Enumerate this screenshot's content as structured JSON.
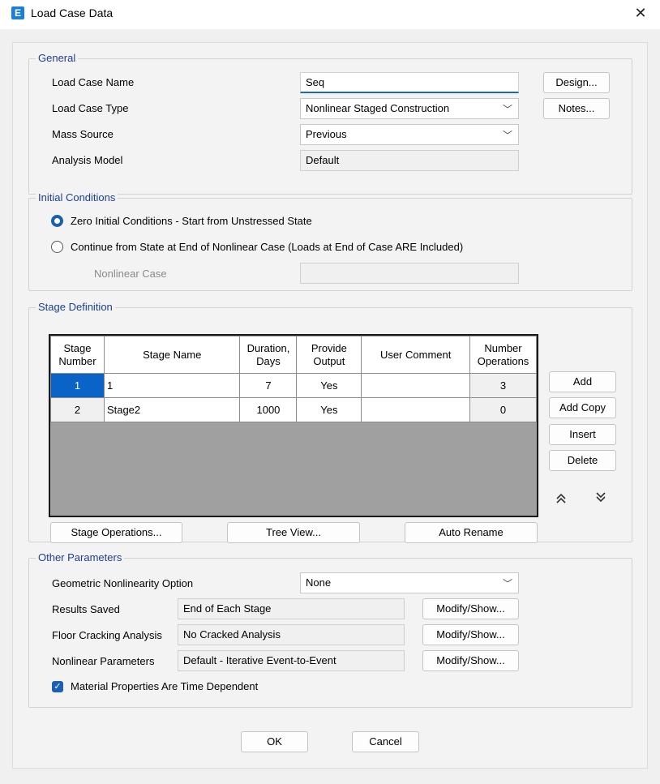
{
  "window": {
    "title": "Load Case Data",
    "icon_letter": "E",
    "close": "✕"
  },
  "general": {
    "legend": "General",
    "name_label": "Load Case Name",
    "name_value": "Seq",
    "type_label": "Load Case Type",
    "type_value": "Nonlinear Staged Construction",
    "mass_label": "Mass Source",
    "mass_value": "Previous",
    "model_label": "Analysis Model",
    "model_value": "Default",
    "design_btn": "Design...",
    "notes_btn": "Notes..."
  },
  "initial": {
    "legend": "Initial Conditions",
    "option1": "Zero Initial Conditions - Start from Unstressed State",
    "option2": "Continue from State at End of Nonlinear Case  (Loads at End of Case ARE Included)",
    "nl_case_label": "Nonlinear Case",
    "nl_case_value": "",
    "selected": "option1"
  },
  "stage": {
    "legend": "Stage Definition",
    "headers": {
      "num_1": "Stage",
      "num_2": "Number",
      "name": "Stage Name",
      "dur_1": "Duration,",
      "dur_2": "Days",
      "out_1": "Provide",
      "out_2": "Output",
      "comment": "User Comment",
      "ops_1": "Number",
      "ops_2": "Operations"
    },
    "rows": [
      {
        "number": "1",
        "name": "1",
        "duration": "7",
        "output": "Yes",
        "comment": "",
        "operations": "3"
      },
      {
        "number": "2",
        "name": "Stage2",
        "duration": "1000",
        "output": "Yes",
        "comment": "",
        "operations": "0"
      }
    ],
    "add_btn": "Add",
    "add_copy_btn": "Add Copy",
    "insert_btn": "Insert",
    "delete_btn": "Delete",
    "move_up_icon": "double-chevron-up",
    "move_down_icon": "double-chevron-down",
    "stage_ops_btn": "Stage Operations...",
    "tree_view_btn": "Tree View...",
    "auto_rename_btn": "Auto Rename"
  },
  "other": {
    "legend": "Other Parameters",
    "geo_label": "Geometric Nonlinearity Option",
    "geo_value": "None",
    "results_label": "Results Saved",
    "results_value": "End of Each Stage",
    "floor_label": "Floor Cracking Analysis",
    "floor_value": "No Cracked Analysis",
    "nl_label": "Nonlinear Parameters",
    "nl_value": "Default - Iterative Event-to-Event",
    "modify_btn": "Modify/Show...",
    "material_label": "Material Properties Are Time Dependent",
    "material_checked": true
  },
  "footer": {
    "ok": "OK",
    "cancel": "Cancel"
  },
  "colors": {
    "accent": "#1a5fb4",
    "legend_text": "#1c3f94",
    "selected_cell": "#0a64c8",
    "grid_empty": "#a0a0a0"
  }
}
